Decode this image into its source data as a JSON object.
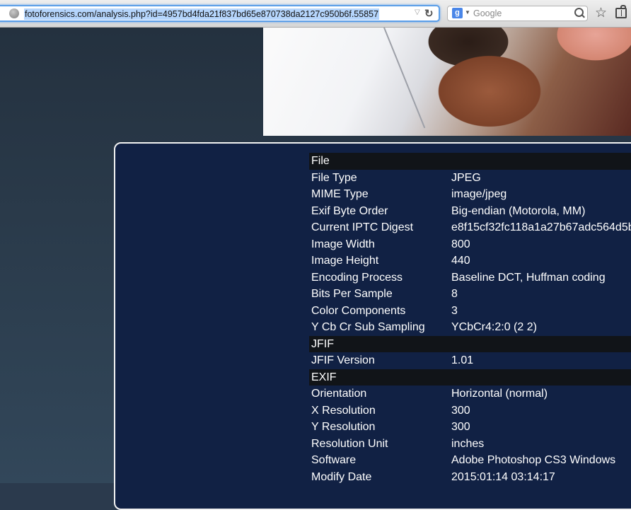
{
  "browser": {
    "url": "fotoforensics.com/analysis.php?id=4957bd4fda21f837bd65e870738da2127c950b6f.55857",
    "search_placeholder": "Google",
    "search_engine_letter": "g"
  },
  "metadata": {
    "sections": [
      {
        "title": "File",
        "rows": [
          {
            "key": "File Type",
            "value": "JPEG"
          },
          {
            "key": "MIME Type",
            "value": "image/jpeg"
          },
          {
            "key": "Exif Byte Order",
            "value": "Big-endian (Motorola, MM)"
          },
          {
            "key": "Current IPTC Digest",
            "value": "e8f15cf32fc118a1a27b67adc564d5b"
          },
          {
            "key": "Image Width",
            "value": "800"
          },
          {
            "key": "Image Height",
            "value": "440"
          },
          {
            "key": "Encoding Process",
            "value": "Baseline DCT, Huffman coding"
          },
          {
            "key": "Bits Per Sample",
            "value": "8"
          },
          {
            "key": "Color Components",
            "value": "3"
          },
          {
            "key": "Y Cb Cr Sub Sampling",
            "value": "YCbCr4:2:0 (2 2)"
          }
        ]
      },
      {
        "title": "JFIF",
        "rows": [
          {
            "key": "JFIF Version",
            "value": "1.01"
          }
        ]
      },
      {
        "title": "EXIF",
        "rows": [
          {
            "key": "Orientation",
            "value": "Horizontal (normal)"
          },
          {
            "key": "X Resolution",
            "value": "300"
          },
          {
            "key": "Y Resolution",
            "value": "300"
          },
          {
            "key": "Resolution Unit",
            "value": "inches"
          },
          {
            "key": "Software",
            "value": "Adobe Photoshop CS3 Windows"
          },
          {
            "key": "Modify Date",
            "value": "2015:01:14 03:14:17"
          }
        ]
      }
    ]
  },
  "colors": {
    "page_bg": "#2b3a4d",
    "panel_bg": "#112144",
    "section_header_bg": "#111418",
    "url_focus": "#5b9ee8"
  },
  "icons": {
    "site": "globe-icon",
    "reload": "reload-icon",
    "search": "magnifier-icon",
    "bookmark": "star-icon",
    "reading_list": "reading-list-icon"
  }
}
